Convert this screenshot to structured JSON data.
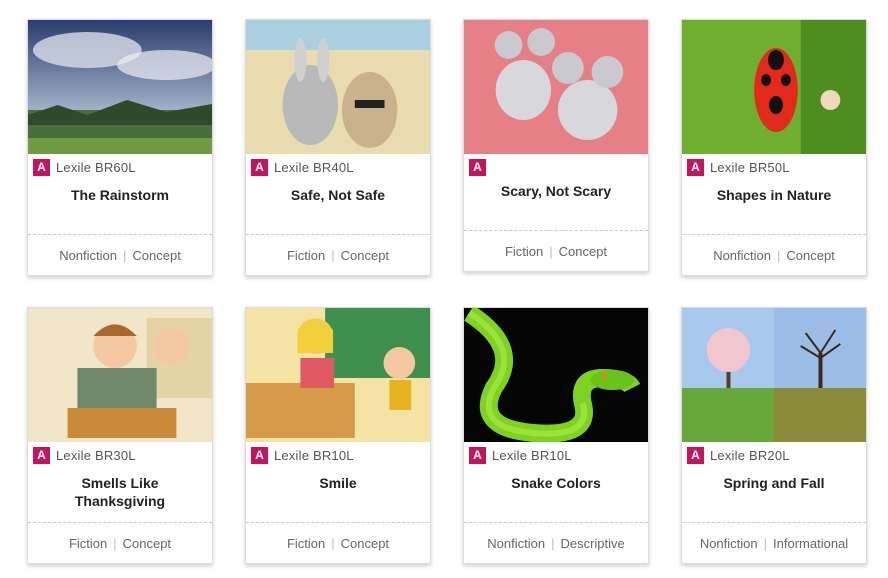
{
  "cards": [
    {
      "lexile": "Lexile BR60L",
      "title": "The Rainstorm",
      "tags": [
        "Nonfiction",
        "Concept"
      ]
    },
    {
      "lexile": "Lexile BR40L",
      "title": "Safe, Not Safe",
      "tags": [
        "Fiction",
        "Concept"
      ]
    },
    {
      "lexile": "",
      "title": "Scary, Not Scary",
      "tags": [
        "Fiction",
        "Concept"
      ]
    },
    {
      "lexile": "Lexile BR50L",
      "title": "Shapes in Nature",
      "tags": [
        "Nonfiction",
        "Concept"
      ]
    },
    {
      "lexile": "Lexile BR30L",
      "title": "Smells Like Thanksgiving",
      "tags": [
        "Fiction",
        "Concept"
      ]
    },
    {
      "lexile": "Lexile BR10L",
      "title": "Smile",
      "tags": [
        "Fiction",
        "Concept"
      ]
    },
    {
      "lexile": "Lexile BR10L",
      "title": "Snake Colors",
      "tags": [
        "Nonfiction",
        "Descriptive"
      ]
    },
    {
      "lexile": "Lexile BR20L",
      "title": "Spring and Fall",
      "tags": [
        "Nonfiction",
        "Informational"
      ]
    }
  ],
  "level_badge": "A",
  "accent_color": "#c4145e"
}
